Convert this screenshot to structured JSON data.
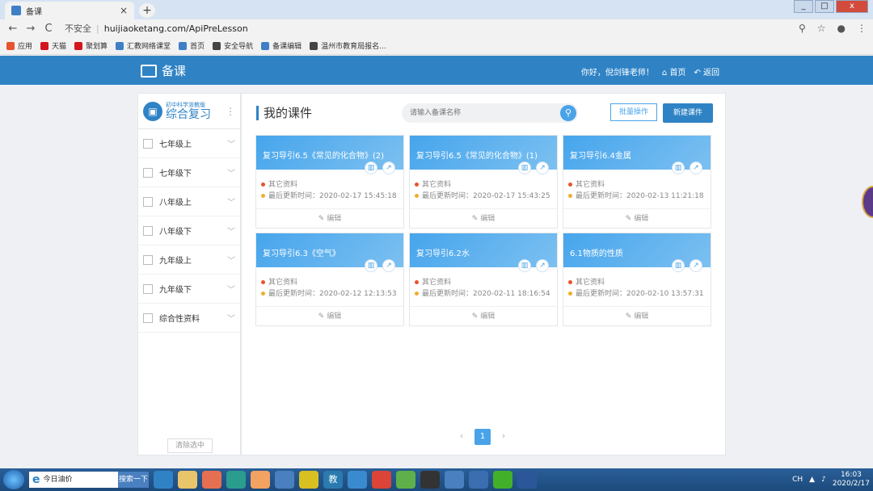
{
  "browser": {
    "tab_title": "备课",
    "tab_close": "×",
    "new_tab": "+",
    "nav_back": "←",
    "nav_forward": "→",
    "nav_reload": "C",
    "insecure_label": "不安全",
    "url": "huijiaoketang.com/ApiPreLesson",
    "bookmarks": [
      {
        "label": "应用",
        "color": "#e8532f"
      },
      {
        "label": "天猫",
        "color": "#d4161c"
      },
      {
        "label": "聚划算",
        "color": "#d4161c"
      },
      {
        "label": "汇教网络课堂",
        "color": "#3f7fc6"
      },
      {
        "label": "首页",
        "color": "#3f7fc6"
      },
      {
        "label": "安全导航",
        "color": "#444444"
      },
      {
        "label": "备课编辑",
        "color": "#3f7fc6"
      },
      {
        "label": "温州市教育局报名...",
        "color": "#444444"
      }
    ]
  },
  "header": {
    "title": "备课",
    "greeting": "你好，倪剑锋老师！",
    "home": "首页",
    "back": "返回"
  },
  "sidebar": {
    "subject_sub": "初中科学浙教版",
    "subject_main": "综合复习",
    "grades": [
      "七年级上",
      "七年级下",
      "八年级上",
      "八年级下",
      "九年级上",
      "九年级下",
      "综合性资料"
    ],
    "clear_label": "清除选中"
  },
  "main": {
    "title": "我的课件",
    "search_placeholder": "请输入备课名称",
    "batch_label": "批量操作",
    "new_label": "新建课件",
    "edit_label": "编辑",
    "type_label": "其它资料",
    "cards": [
      {
        "title": "复习导引6.5《常见的化合物》(2)",
        "updated": "最后更新时间：2020-02-17 15:45:18"
      },
      {
        "title": "复习导引6.5《常见的化合物》(1)",
        "updated": "最后更新时间：2020-02-17 15:43:25"
      },
      {
        "title": "复习导引6.4金属",
        "updated": "最后更新时间：2020-02-13 11:21:18"
      },
      {
        "title": "复习导引6.3《空气》",
        "updated": "最后更新时间：2020-02-12 12:13:53"
      },
      {
        "title": "复习导引6.2水",
        "updated": "最后更新时间：2020-02-11 18:16:54"
      },
      {
        "title": "6.1物质的性质",
        "updated": "最后更新时间：2020-02-10 13:57:31"
      }
    ],
    "pager": {
      "prev": "‹",
      "current": "1",
      "next": "›"
    }
  },
  "taskbar": {
    "search_text": "今日油价",
    "search_btn": "搜索一下",
    "teach_label": "教",
    "ime": "CH",
    "time": "16:03",
    "date": "2020/2/17"
  }
}
